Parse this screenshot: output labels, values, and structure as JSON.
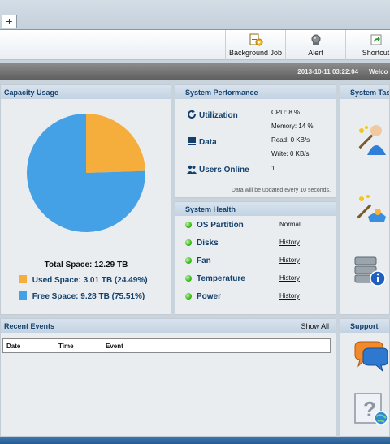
{
  "tabs": {
    "add_label": "+"
  },
  "toolbar": {
    "buttons": [
      {
        "label": "Background Job",
        "icon": "background-job-icon"
      },
      {
        "label": "Alert",
        "icon": "alert-bell-icon"
      },
      {
        "label": "Shortcut",
        "icon": "shortcut-icon"
      }
    ]
  },
  "status_bar": {
    "datetime": "2013-10-11 03:22:04",
    "welcome": "Welco"
  },
  "capacity": {
    "title": "Capacity Usage",
    "total_label": "Total Space:",
    "total_value": "12.29 TB",
    "used_label": "Used Space:",
    "used_value": "3.01 TB (24.49%)",
    "free_label": "Free Space:",
    "free_value": "9.28 TB (75.51%)",
    "used_percent": 24.49,
    "free_percent": 75.51,
    "colors": {
      "used": "#f5ad3b",
      "free": "#45a1e6"
    }
  },
  "chart_data": {
    "type": "pie",
    "categories": [
      "Used Space",
      "Free Space"
    ],
    "values": [
      24.49,
      75.51
    ],
    "title": "",
    "colors": [
      "#f5ad3b",
      "#45a1e6"
    ]
  },
  "performance": {
    "title": "System Performance",
    "utilization_label": "Utilization",
    "cpu": "CPU: 8 %",
    "memory": "Memory: 14 %",
    "data_label": "Data",
    "read": "Read: 0 KB/s",
    "write": "Write: 0 KB/s",
    "users_label": "Users Online",
    "users_count": "1",
    "note": "Data will be updated every 10 seconds."
  },
  "health": {
    "title": "System Health",
    "rows": [
      {
        "label": "OS Partition",
        "value": "Normal"
      },
      {
        "label": "Disks",
        "value": "History"
      },
      {
        "label": "Fan",
        "value": "History"
      },
      {
        "label": "Temperature",
        "value": "History"
      },
      {
        "label": "Power",
        "value": "History"
      }
    ]
  },
  "tasks": {
    "title": "System Task"
  },
  "events": {
    "title": "Recent Events",
    "show_all": "Show All",
    "columns": [
      "Date",
      "Time",
      "Event"
    ]
  },
  "support": {
    "title": "Support"
  }
}
